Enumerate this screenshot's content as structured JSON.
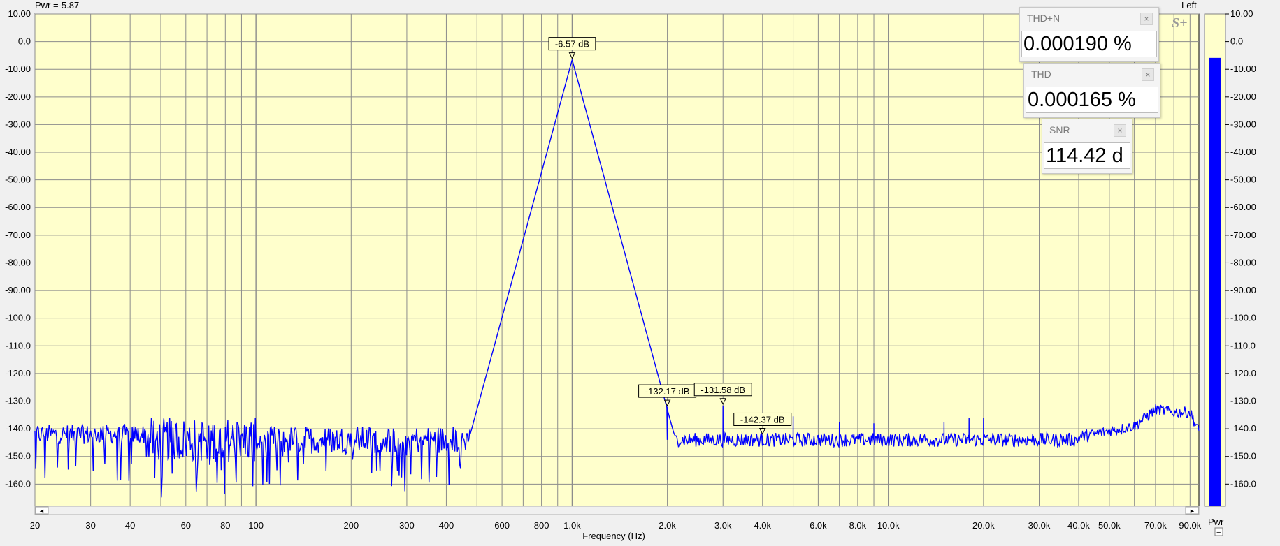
{
  "header": {
    "power_readout": "Pwr =-5.87",
    "channel": "Left"
  },
  "logo": "S+",
  "meters": [
    {
      "title": "THD+N",
      "value": "0.000190 %",
      "close": "×"
    },
    {
      "title": "THD",
      "value": "0.000165 %",
      "close": "×"
    },
    {
      "title": "SNR",
      "value": "114.42 d",
      "close": "×"
    }
  ],
  "right_axis_label": "Pwr",
  "collapse_glyph": "−",
  "scroll": {
    "left": "◄",
    "right": "►"
  },
  "colors": {
    "plot_bg": "#ffffcc",
    "grid": "#8c8c8c",
    "trace": "#0000ff",
    "bar": "#0000ff"
  },
  "chart_data": {
    "type": "line",
    "xlabel": "Frequency (Hz)",
    "ylabel": "",
    "xscale": "log",
    "xlim": [
      20,
      96000
    ],
    "ylim": [
      -168,
      10
    ],
    "yticks": [
      10,
      0,
      -10,
      -20,
      -30,
      -40,
      -50,
      -60,
      -70,
      -80,
      -90,
      -100,
      -110,
      -120,
      -130,
      -140,
      -150,
      -160
    ],
    "ytick_labels": [
      "10.00",
      "0.0",
      "-10.00",
      "-20.00",
      "-30.00",
      "-40.00",
      "-50.00",
      "-60.00",
      "-70.00",
      "-80.00",
      "-90.00",
      "-100.0",
      "-110.0",
      "-120.0",
      "-130.0",
      "-140.0",
      "-150.0",
      "-160.0"
    ],
    "right_ytick_labels": [
      "10.00",
      "0.0",
      "-10.00",
      "-20.00",
      "-30.00",
      "-40.00",
      "-50.00",
      "-60.00",
      "-70.00",
      "-80.00",
      "-90.00",
      "-100.0",
      "-110.0",
      "-120.0",
      "-130.0",
      "-140.0",
      "-150.0",
      "-160.0"
    ],
    "xticks": [
      {
        "v": 20,
        "t": "20"
      },
      {
        "v": 30,
        "t": "30"
      },
      {
        "v": 40,
        "t": "40"
      },
      {
        "v": 60,
        "t": "60"
      },
      {
        "v": 80,
        "t": "80"
      },
      {
        "v": 100,
        "t": "100"
      },
      {
        "v": 200,
        "t": "200"
      },
      {
        "v": 300,
        "t": "300"
      },
      {
        "v": 400,
        "t": "400"
      },
      {
        "v": 600,
        "t": "600"
      },
      {
        "v": 800,
        "t": "800"
      },
      {
        "v": 1000,
        "t": "1.0k"
      },
      {
        "v": 2000,
        "t": "2.0k"
      },
      {
        "v": 3000,
        "t": "3.0k"
      },
      {
        "v": 4000,
        "t": "4.0k"
      },
      {
        "v": 6000,
        "t": "6.0k"
      },
      {
        "v": 8000,
        "t": "8.0k"
      },
      {
        "v": 10000,
        "t": "10.0k"
      },
      {
        "v": 20000,
        "t": "20.0k"
      },
      {
        "v": 30000,
        "t": "30.0k"
      },
      {
        "v": 40000,
        "t": "40.0k"
      },
      {
        "v": 50000,
        "t": "50.0k"
      },
      {
        "v": 70000,
        "t": "70.0k"
      },
      {
        "v": 90000,
        "t": "90.0k"
      }
    ],
    "grid": true,
    "markers": [
      {
        "x": 1000,
        "y": -6.57,
        "label": "-6.57 dB"
      },
      {
        "x": 2000,
        "y": -132.17,
        "label": "-132.17 dB"
      },
      {
        "x": 3000,
        "y": -131.58,
        "label": "-131.58 dB"
      },
      {
        "x": 4000,
        "y": -142.37,
        "label": "-142.37 dB"
      }
    ],
    "spectrum": {
      "fundamental_hz": 1000,
      "fundamental_db": -6.57,
      "noise_floor_db": -144,
      "harmonics": [
        {
          "x": 2000,
          "y": -132.17
        },
        {
          "x": 3000,
          "y": -131.58
        },
        {
          "x": 4000,
          "y": -142.37
        },
        {
          "x": 5000,
          "y": -135.5
        },
        {
          "x": 7000,
          "y": -137.5
        },
        {
          "x": 9000,
          "y": -138
        },
        {
          "x": 15000,
          "y": -137.5
        },
        {
          "x": 18000,
          "y": -136
        },
        {
          "x": 20000,
          "y": -136
        }
      ],
      "hf_rise": [
        {
          "x": 40000,
          "y": -143
        },
        {
          "x": 60000,
          "y": -139
        },
        {
          "x": 70000,
          "y": -133
        },
        {
          "x": 80000,
          "y": -134
        },
        {
          "x": 90000,
          "y": -134
        },
        {
          "x": 96000,
          "y": -141
        }
      ]
    },
    "level_bar": {
      "value_db": -5.87
    }
  }
}
